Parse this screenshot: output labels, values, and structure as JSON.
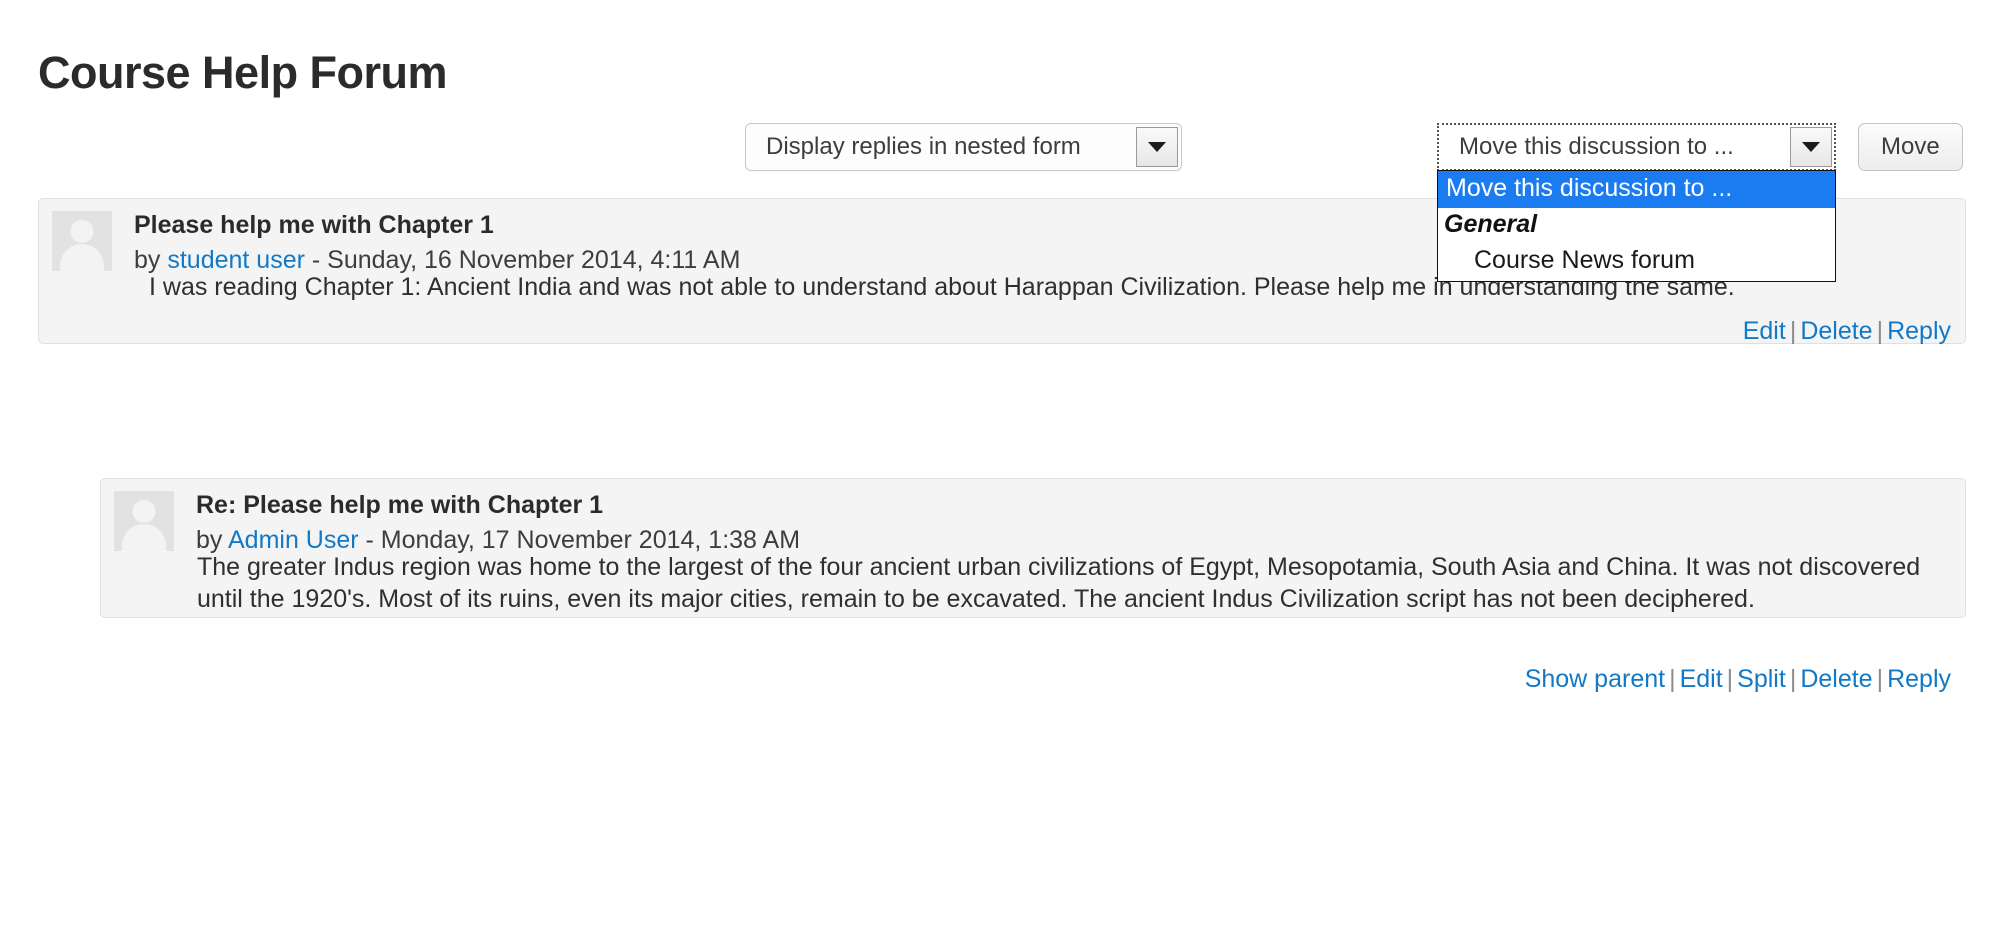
{
  "page": {
    "title": "Course Help Forum"
  },
  "controls": {
    "display_select": {
      "value": "Display replies in nested form",
      "arrow_icon": "chevron-down-icon"
    },
    "move_select": {
      "value": "Move this discussion to ...",
      "arrow_icon": "chevron-down-icon",
      "open": true,
      "options": [
        {
          "label": "Move this discussion to ...",
          "type": "option",
          "selected": true
        },
        {
          "label": "General",
          "type": "optgroup",
          "selected": false
        },
        {
          "label": "Course News forum",
          "type": "option",
          "child": true,
          "selected": false
        }
      ]
    },
    "move_button": {
      "label": "Move"
    }
  },
  "posts": [
    {
      "id": "post-root",
      "avatar_icon": "user-avatar-placeholder-icon",
      "subject": "Please help me with Chapter 1",
      "byline_prefix": "by ",
      "author": "student user",
      "byline_suffix": " - Sunday, 16 November 2014, 4:11 AM",
      "body": "I was reading Chapter 1: Ancient India and was not able to understand about Harappan Civilization. Please help me in understanding the same.",
      "actions": [
        "Edit",
        "Delete",
        "Reply"
      ],
      "separator": "|"
    },
    {
      "id": "post-reply",
      "avatar_icon": "user-avatar-placeholder-icon",
      "subject": "Re: Please help me with Chapter 1",
      "byline_prefix": "by ",
      "author": "Admin User",
      "byline_suffix": " - Monday, 17 November 2014, 1:38 AM",
      "body": "The greater Indus region was home to the largest of the four ancient urban civilizations of Egypt, Mesopotamia, South Asia and China. It was not discovered until the 1920's. Most of its ruins, even its major cities, remain to be excavated. The ancient Indus Civilization script has not been deciphered.",
      "actions": [
        "Show parent",
        "Edit",
        "Split",
        "Delete",
        "Reply"
      ],
      "separator": "|"
    }
  ],
  "colors": {
    "link": "#1279c6",
    "highlight": "#1a7cf0",
    "post_bg": "#f4f4f4",
    "title": "#2b2b2b"
  }
}
